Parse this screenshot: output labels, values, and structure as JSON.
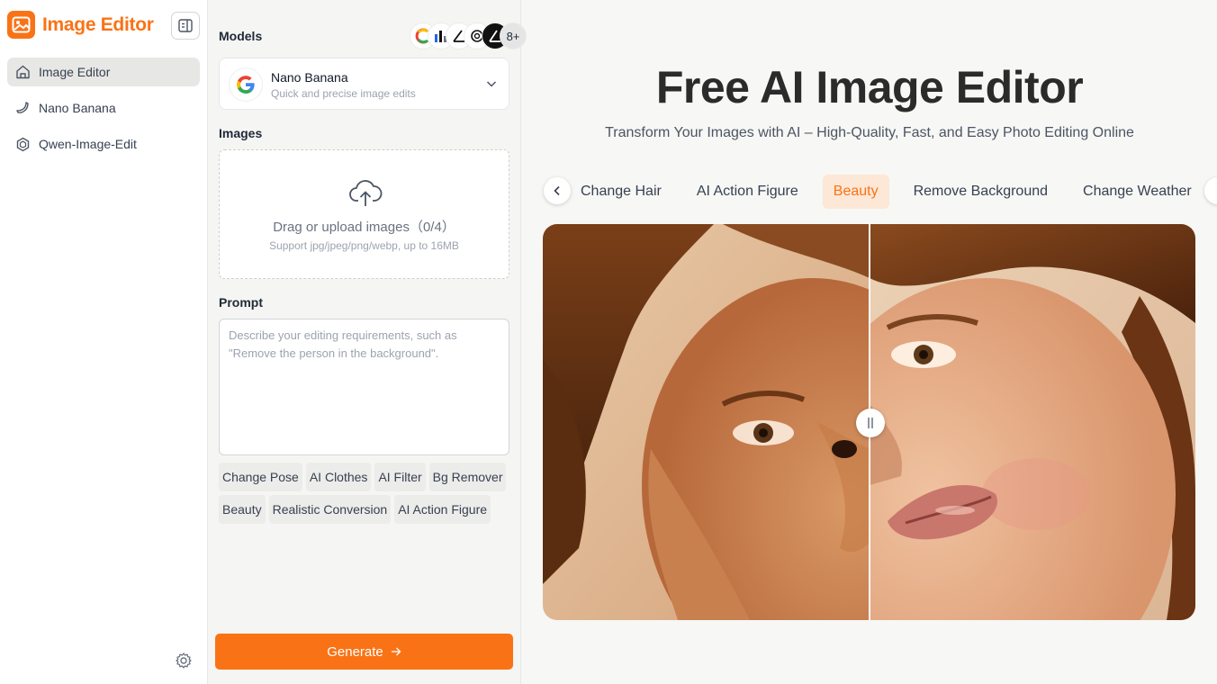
{
  "brand": {
    "name": "Image Editor"
  },
  "sidebar": {
    "items": [
      {
        "label": "Image Editor",
        "icon": "home-icon",
        "active": true
      },
      {
        "label": "Nano Banana",
        "icon": "banana-icon",
        "active": false
      },
      {
        "label": "Qwen-Image-Edit",
        "icon": "qwen-icon",
        "active": false
      }
    ]
  },
  "panel": {
    "models_title": "Models",
    "model_count": "8+",
    "selected_model": {
      "name": "Nano Banana",
      "description": "Quick and precise image edits"
    },
    "images_title": "Images",
    "upload": {
      "title": "Drag or upload images（0/4）",
      "hint": "Support jpg/jpeg/png/webp, up to 16MB"
    },
    "prompt_title": "Prompt",
    "prompt_placeholder": "Describe your editing requirements, such as \"Remove the person in the background\".",
    "chips": [
      "Change Pose",
      "AI Clothes",
      "AI Filter",
      "Bg Remover",
      "Beauty",
      "Realistic Conversion",
      "AI Action Figure"
    ],
    "generate_label": "Generate"
  },
  "main": {
    "title": "Free AI Image Editor",
    "subtitle": "Transform Your Images with AI – High-Quality, Fast, and Easy Photo Editing Online",
    "tabs": [
      {
        "label": "Change Hair",
        "active": false
      },
      {
        "label": "AI Action Figure",
        "active": false
      },
      {
        "label": "Beauty",
        "active": true
      },
      {
        "label": "Remove Background",
        "active": false
      },
      {
        "label": "Change Weather",
        "active": false
      }
    ]
  },
  "colors": {
    "accent": "#f97316",
    "active_tab_bg": "#fde7d6"
  }
}
